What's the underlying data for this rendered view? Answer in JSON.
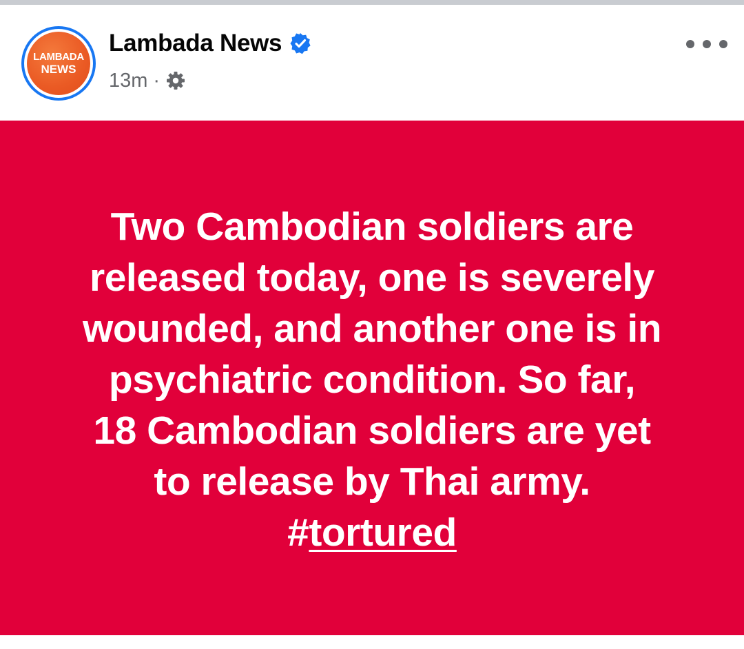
{
  "post": {
    "avatar": {
      "logo_line1": "LAMBADA",
      "logo_line2": "NEWS",
      "ring_color": "#1877f2",
      "logo_color": "#ea5a24"
    },
    "page_name": "Lambada News",
    "verified_icon": "verified-badge-icon",
    "timestamp": "13m",
    "separator": "·",
    "audience_icon": "gear-icon",
    "more_icon": "more-horizontal-icon",
    "card_background": "#e1003a",
    "text_lines": [
      "Two Cambodian soldiers are",
      "released today, one is severely",
      "wounded, and another one is in",
      "psychiatric condition. So far,",
      "18 Cambodian soldiers are yet",
      "to release by Thai army."
    ],
    "hashtag_prefix": "#",
    "hashtag": "tortured"
  }
}
